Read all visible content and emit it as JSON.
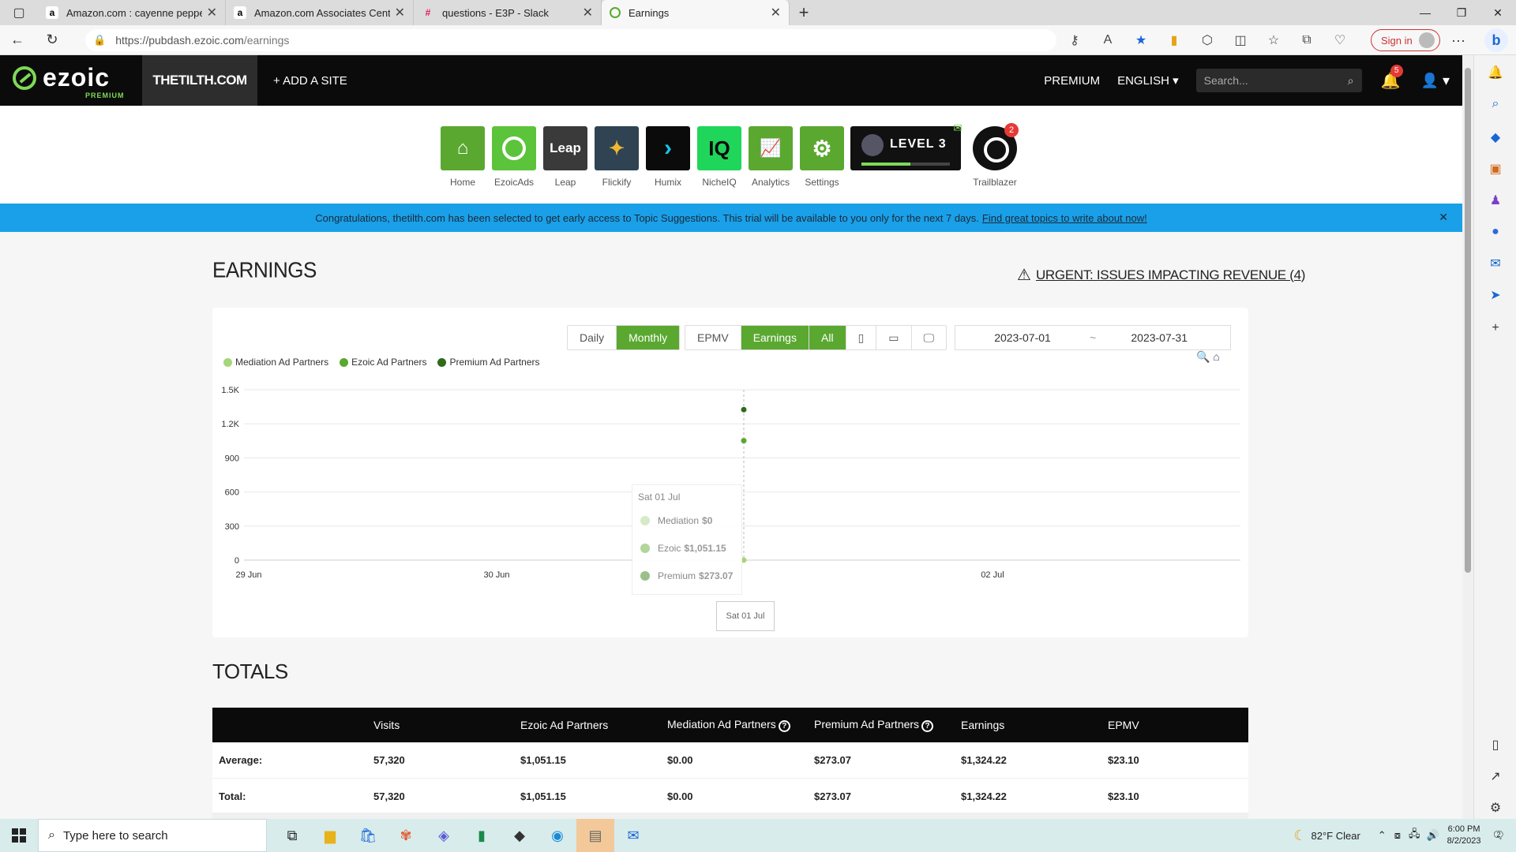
{
  "browser": {
    "tabs": [
      {
        "title": "Amazon.com : cayenne pepper b",
        "icon": "amazon-icon"
      },
      {
        "title": "Amazon.com Associates Central",
        "icon": "amazon-icon"
      },
      {
        "title": "questions - E3P - Slack",
        "icon": "slack-icon"
      },
      {
        "title": "Earnings",
        "icon": "ezoic-icon"
      }
    ],
    "url_host": "https://pubdash.ezoic.com",
    "url_path": "/earnings",
    "sign_in": "Sign in"
  },
  "header": {
    "logo": "ezoic",
    "logo_sub": "PREMIUM",
    "site": "THETILTH.COM",
    "add_site": "+ ADD A SITE",
    "premium": "PREMIUM",
    "language": "ENGLISH",
    "search_placeholder": "Search...",
    "notifications": "5"
  },
  "apps": [
    {
      "label": "Home",
      "icon": "home-icon",
      "color": "#5aa830"
    },
    {
      "label": "EzoicAds",
      "icon": "ezoicads-icon",
      "color": "#5cc43a"
    },
    {
      "label": "Leap",
      "icon": "leap-icon",
      "color": "#3a3a3a",
      "text": "Leap"
    },
    {
      "label": "Flickify",
      "icon": "flickify-icon",
      "color": "#2f4352"
    },
    {
      "label": "Humix",
      "icon": "humix-icon",
      "color": "#0b0b0b"
    },
    {
      "label": "NicheIQ",
      "icon": "nicheiq-icon",
      "color": "#1fd65b",
      "text": "IQ"
    },
    {
      "label": "Analytics",
      "icon": "analytics-icon",
      "color": "#5aa830"
    },
    {
      "label": "Settings",
      "icon": "settings-icon",
      "color": "#5aa830"
    }
  ],
  "level": {
    "text": "LEVEL 3"
  },
  "trailblazer": {
    "label": "Trailblazer",
    "badge": "2"
  },
  "banner": {
    "text": "Congratulations, thetilth.com has been selected to get early access to Topic Suggestions. This trial will be available to you only for the next 7 days.",
    "link": "Find great topics to write about now!"
  },
  "earnings": {
    "title": "EARNINGS",
    "urgent": "URGENT: ISSUES IMPACTING REVENUE (4)",
    "period_buttons": [
      "Daily",
      "Monthly"
    ],
    "metric_buttons": [
      "EPMV",
      "Earnings"
    ],
    "device_all": "All",
    "date_from": "2023-07-01",
    "date_sep": "~",
    "date_to": "2023-07-31"
  },
  "chart_data": {
    "type": "scatter",
    "x_ticks": [
      "29 Jun",
      "30 Jun",
      "Sat 01 Jul",
      "02 Jul"
    ],
    "y_ticks": [
      "0",
      "300",
      "600",
      "900",
      "1.2K",
      "1.5K"
    ],
    "ylim": [
      0,
      1500
    ],
    "grid": true,
    "legend_position": "top-left",
    "series": [
      {
        "name": "Mediation Ad Partners",
        "color": "#a5d67a",
        "points": [
          {
            "x": "Sat 01 Jul",
            "y": 0
          }
        ]
      },
      {
        "name": "Ezoic Ad Partners",
        "color": "#5aa830",
        "points": [
          {
            "x": "Sat 01 Jul",
            "y": 1051.15
          }
        ]
      },
      {
        "name": "Premium Ad Partners",
        "color": "#2e6b1a",
        "points": [
          {
            "x": "Sat 01 Jul",
            "y": 1324.22
          }
        ]
      }
    ],
    "tooltip": {
      "header": "Sat 01 Jul",
      "rows": [
        {
          "label": "Mediation",
          "value": "$0"
        },
        {
          "label": "Ezoic",
          "value": "$1,051.15"
        },
        {
          "label": "Premium",
          "value": "$273.07"
        }
      ]
    },
    "x_flag": "Sat 01 Jul"
  },
  "totals": {
    "title": "TOTALS",
    "columns": [
      "",
      "Visits",
      "Ezoic Ad Partners",
      "Mediation Ad Partners",
      "Premium Ad Partners",
      "Earnings",
      "EPMV"
    ],
    "rows": [
      {
        "label": "Average:",
        "cells": [
          "57,320",
          "$1,051.15",
          "$0.00",
          "$273.07",
          "$1,324.22",
          "$23.10"
        ]
      },
      {
        "label": "Total:",
        "cells": [
          "57,320",
          "$1,051.15",
          "$0.00",
          "$273.07",
          "$1,324.22",
          "$23.10"
        ]
      }
    ]
  },
  "taskbar": {
    "search": "Type here to search",
    "weather": "82°F  Clear",
    "time": "6:00 PM",
    "date": "8/2/2023",
    "notif": "2"
  }
}
